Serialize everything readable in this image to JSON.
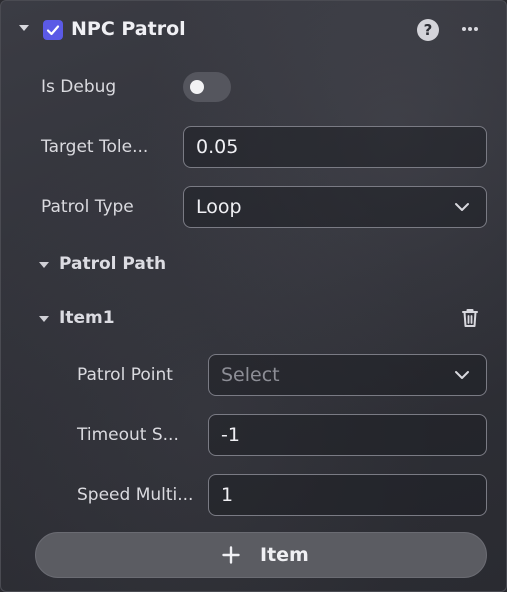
{
  "component": {
    "title": "NPC Patrol",
    "enabled": true,
    "help_label": "?"
  },
  "fields": {
    "is_debug": {
      "label": "Is Debug",
      "value": false
    },
    "target_tolerance": {
      "label": "Target Tole...",
      "value": "0.05"
    },
    "patrol_type": {
      "label": "Patrol Type",
      "value": "Loop"
    }
  },
  "patrol_path": {
    "title": "Patrol Path",
    "items": [
      {
        "title": "Item1",
        "patrol_point": {
          "label": "Patrol Point",
          "placeholder": "Select"
        },
        "timeout": {
          "label": "Timeout S...",
          "value": "-1"
        },
        "speed_multiplier": {
          "label": "Speed Multi...",
          "value": "1"
        }
      }
    ],
    "add_button_label": "Item"
  },
  "colors": {
    "accent": "#5b5ae6",
    "panel_bg": "#2f3037",
    "field_border": "#7a7b84"
  },
  "icons": [
    "chevron-down-icon",
    "checkbox-checked-icon",
    "help-icon",
    "more-icon",
    "trash-icon",
    "plus-icon"
  ]
}
